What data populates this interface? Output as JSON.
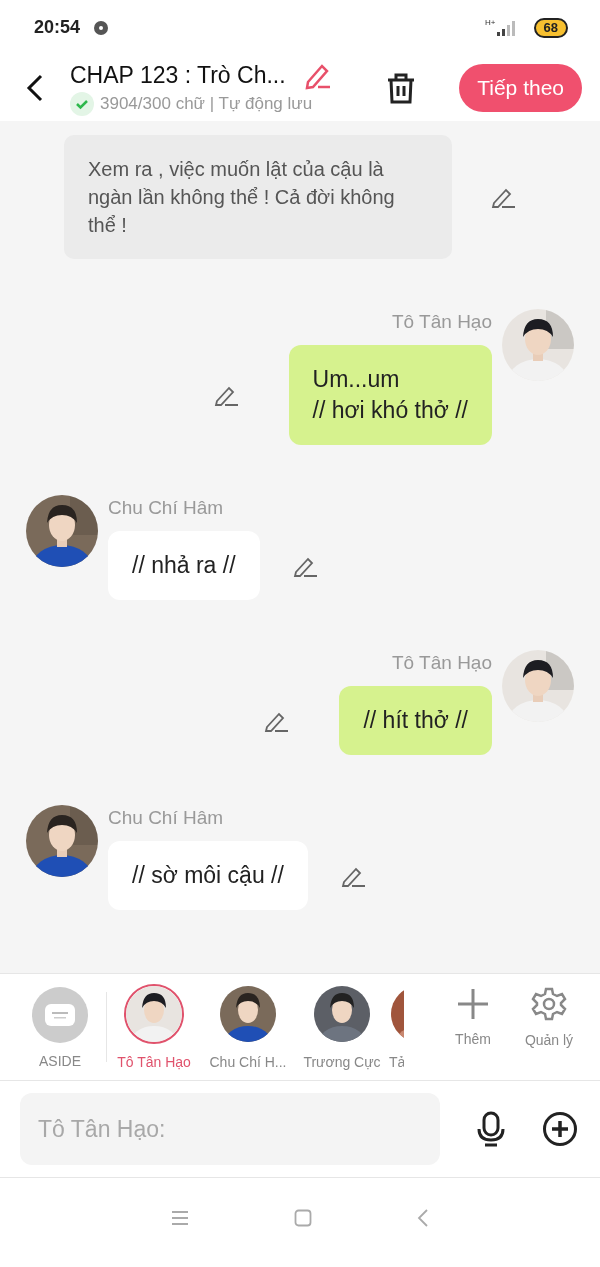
{
  "status_bar": {
    "time": "20:54",
    "network": "H+",
    "battery": "68"
  },
  "header": {
    "title": "CHAP 123 : Trò Ch...",
    "subtitle": "3904/300 chữ | Tự động lưu",
    "next_button": "Tiếp theo"
  },
  "messages": [
    {
      "kind": "aside",
      "text": "Xem ra , việc muốn lật của cậu là ngàn lần không thể ! Cả đời không thể !"
    },
    {
      "kind": "right",
      "name": "Tô Tân Hạo",
      "text": "Um...um\n// hơi khó thở //"
    },
    {
      "kind": "left",
      "name": "Chu Chí Hâm",
      "text": "// nhả ra //"
    },
    {
      "kind": "right",
      "name": "Tô Tân Hạo",
      "text": "// hít thở //"
    },
    {
      "kind": "left",
      "name": "Chu Chí Hâm",
      "text": "// sờ môi cậu //"
    }
  ],
  "characters": [
    {
      "kind": "aside",
      "label": "ASIDE",
      "selected": false
    },
    {
      "kind": "character",
      "label": "Tô Tân Hạo",
      "selected": true
    },
    {
      "kind": "character",
      "label": "Chu Chí H...",
      "selected": false
    },
    {
      "kind": "character",
      "label": "Trương Cực",
      "selected": false
    },
    {
      "kind": "partial",
      "label": "Tả",
      "selected": false
    }
  ],
  "actions": [
    {
      "kind": "add",
      "label": "Thêm"
    },
    {
      "kind": "manage",
      "label": "Quản lý"
    }
  ],
  "composer": {
    "placeholder": "Tô Tân Hạo:"
  }
}
